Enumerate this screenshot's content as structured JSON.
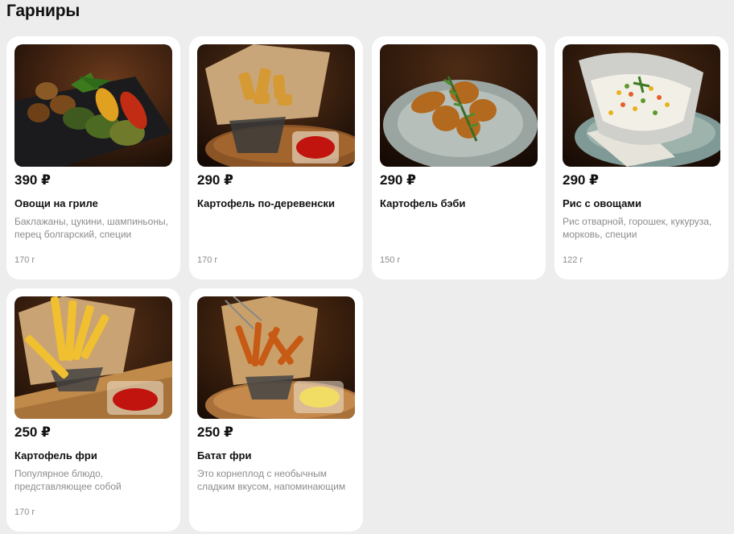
{
  "section_title": "Гарниры",
  "items": [
    {
      "price": "390 ₽",
      "name": "Овощи на гриле",
      "description": "Баклажаны, цукини, шампиньоны, перец болгарский, специи",
      "weight": "170 г"
    },
    {
      "price": "290 ₽",
      "name": "Картофель по-деревенски",
      "description": "",
      "weight": "170 г"
    },
    {
      "price": "290 ₽",
      "name": "Картофель бэби",
      "description": "",
      "weight": "150 г"
    },
    {
      "price": "290 ₽",
      "name": "Рис с овощами",
      "description": "Рис отварной, горошек, кукуруза, морковь, специи",
      "weight": "122 г"
    },
    {
      "price": "250 ₽",
      "name": "Картофель фри",
      "description": "Популярное блюдо, представляющее собой",
      "weight": "170 г"
    },
    {
      "price": "250 ₽",
      "name": "Батат фри",
      "description": "Это корнеплод с необычным сладким вкусом, напоминающим",
      "weight": ""
    }
  ]
}
